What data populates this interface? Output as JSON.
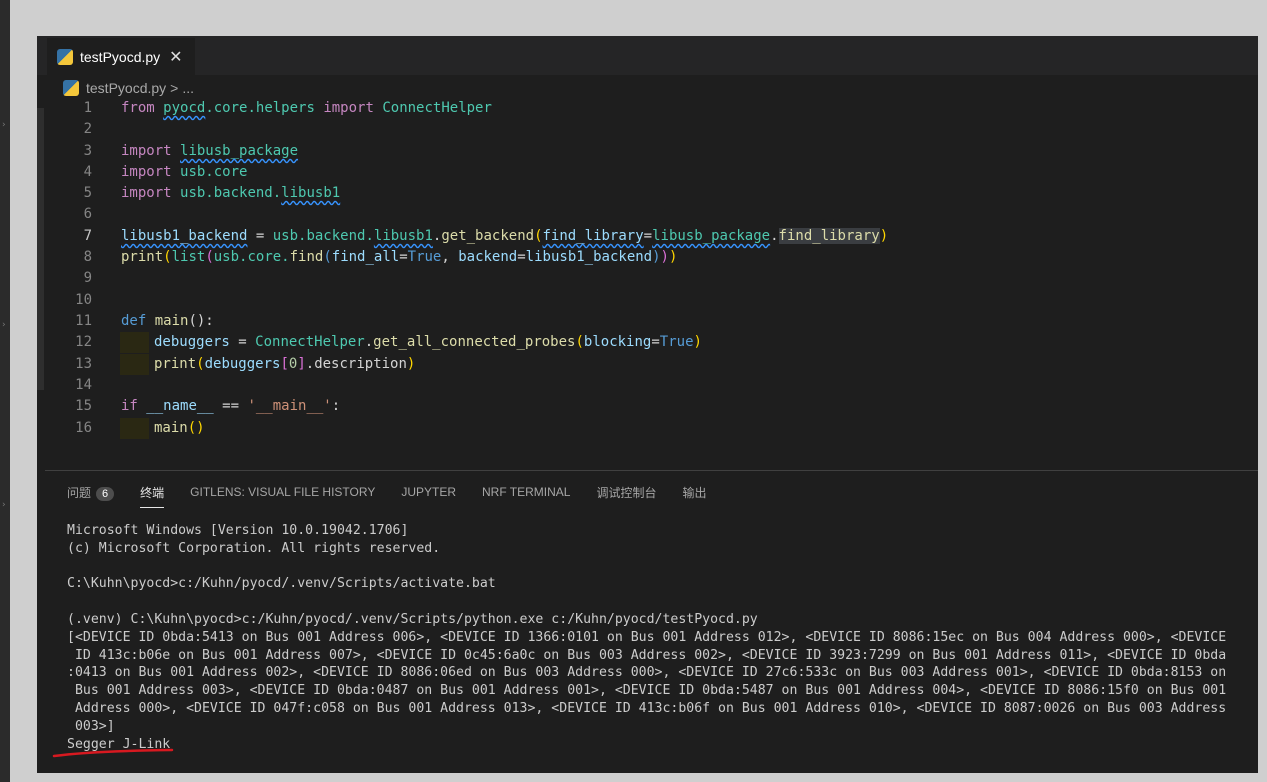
{
  "tab": {
    "label": "testPyocd.py",
    "close_glyph": "✕"
  },
  "breadcrumb": {
    "file": "testPyocd.py",
    "separator": ">",
    "more": "..."
  },
  "editor": {
    "line_numbers": [
      "1",
      "2",
      "3",
      "4",
      "5",
      "6",
      "7",
      "8",
      "9",
      "10",
      "11",
      "12",
      "13",
      "14",
      "15",
      "16"
    ],
    "l1": {
      "kw": "from",
      "mod": "pyocd",
      "rest": ".core.helpers",
      "kw2": "import",
      "cls": "ConnectHelper"
    },
    "l3": {
      "kw": "import",
      "mod": "libusb_package"
    },
    "l4": {
      "kw": "import",
      "mod": "usb.core"
    },
    "l5": {
      "kw": "import",
      "mod_a": "usb.backend.",
      "mod_b": "libusb1"
    },
    "l7": {
      "var": "libusb1_backend",
      "eq": " = ",
      "obj": "usb.backend.",
      "sub": "libusb1",
      "dot": ".",
      "fn": "get_backend",
      "open": "(",
      "arg": "find_library",
      "eq2": "=",
      "val": "libusb_package",
      "dot2": ".",
      "val2": "find_library",
      "close": ")"
    },
    "l8": {
      "fn": "print",
      "o1": "(",
      "fn2": "list",
      "o2": "(",
      "obj": "usb.core.",
      "fn3": "find",
      "o3": "(",
      "a1": "find_all",
      "eq": "=",
      "b1": "True",
      "sep": ", ",
      "a2": "backend",
      "eq2": "=",
      "v2": "libusb1_backend",
      "c3": ")",
      "c2": ")",
      "c1": ")"
    },
    "l11": {
      "kw": "def",
      "fn": "main",
      "rest": "():"
    },
    "l12": {
      "var": "debuggers",
      "eq": " = ",
      "cls": "ConnectHelper",
      "dot": ".",
      "fn": "get_all_connected_probes",
      "open": "(",
      "arg": "blocking",
      "eq2": "=",
      "val": "True",
      "close": ")"
    },
    "l13": {
      "fn": "print",
      "open": "(",
      "var": "debuggers",
      "lb": "[",
      "num": "0",
      "rb": "]",
      "rest": ".description",
      "close": ")"
    },
    "l15": {
      "kw": "if",
      "var": "__name__",
      "op": " == ",
      "str": "'__main__'",
      "colon": ":"
    },
    "l16": {
      "fn": "main",
      "paren": "()"
    }
  },
  "panel": {
    "tabs": [
      {
        "label": "问题",
        "badge": "6"
      },
      {
        "label": "终端"
      },
      {
        "label": "GITLENS: VISUAL FILE HISTORY"
      },
      {
        "label": "JUPYTER"
      },
      {
        "label": "NRF TERMINAL"
      },
      {
        "label": "调试控制台"
      },
      {
        "label": "输出"
      }
    ]
  },
  "terminal": {
    "line1": "Microsoft Windows [Version 10.0.19042.1706]",
    "line2": "(c) Microsoft Corporation. All rights reserved.",
    "line3": "C:\\Kuhn\\pyocd>c:/Kuhn/pyocd/.venv/Scripts/activate.bat",
    "line4": "(.venv) C:\\Kuhn\\pyocd>c:/Kuhn/pyocd/.venv/Scripts/python.exe c:/Kuhn/pyocd/testPyocd.py",
    "output_lines": [
      "[<DEVICE ID 0bda:5413 on Bus 001 Address 006>, <DEVICE ID 1366:0101 on Bus 001 Address 012>, <DEVICE ID 8086:15ec on Bus 004 Address 000>, <DEVICE",
      " ID 413c:b06e on Bus 001 Address 007>, <DEVICE ID 0c45:6a0c on Bus 003 Address 002>, <DEVICE ID 3923:7299 on Bus 001 Address 011>, <DEVICE ID 0bda",
      ":0413 on Bus 001 Address 002>, <DEVICE ID 8086:06ed on Bus 003 Address 000>, <DEVICE ID 27c6:533c on Bus 003 Address 001>, <DEVICE ID 0bda:8153 on",
      " Bus 001 Address 003>, <DEVICE ID 0bda:0487 on Bus 001 Address 001>, <DEVICE ID 0bda:5487 on Bus 001 Address 004>, <DEVICE ID 8086:15f0 on Bus 001",
      " Address 000>, <DEVICE ID 047f:c058 on Bus 001 Address 013>, <DEVICE ID 413c:b06f on Bus 001 Address 010>, <DEVICE ID 8087:0026 on Bus 003 Address",
      " 003>]"
    ],
    "result": "Segger J-Link"
  },
  "colors": {
    "annotation": "#d71920"
  }
}
